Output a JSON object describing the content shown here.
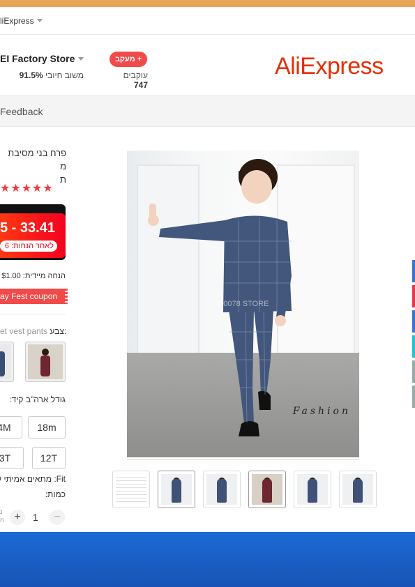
{
  "colors": {
    "brand": "#e62e04",
    "accent": "#f24949",
    "taskbar": "#1a5fc8"
  },
  "topbar": {
    "store_menu": "liExpress"
  },
  "store": {
    "name": "EI Factory Store",
    "rating_value": "91.5%",
    "rating_label": "משוב חיובי",
    "follow_label": "מעקב",
    "follow_plus": "+",
    "followers_value": "747",
    "followers_label": "עוקבים"
  },
  "logo": {
    "text": "AliExpress"
  },
  "nav": {
    "feedback": "Feedback"
  },
  "product": {
    "title_line1": "פרח בני מסיבת מ",
    "title_line2": "ת",
    "stars": "★★★★★",
    "price": "5 - 33.41",
    "price_after_label": "לאחר הנחות: 6",
    "instant_discount": "הנחה מיידית: $1.00 ‏$",
    "coupon": "ay Fest coupon",
    "watermark": "490078 STORE",
    "fashion_text": "Fashion"
  },
  "color_option": {
    "label": "צבע:",
    "value": "et vest pants"
  },
  "size": {
    "label": "גודל ארה\"ב קיד:",
    "options": [
      "4M",
      "18m",
      "3T",
      "12T"
    ]
  },
  "fit": {
    "text": "Fit: מתאים אמיתי לג"
  },
  "quantity": {
    "label": "כמות:",
    "value": "1",
    "minus": "−",
    "plus": "+",
    "note": "נ\nח"
  },
  "thumbnails": [
    "size-chart",
    "blue-suit-front",
    "blue-suit-side",
    "burgundy-suit",
    "blue-suit-pose",
    "blue-suit-walk"
  ]
}
